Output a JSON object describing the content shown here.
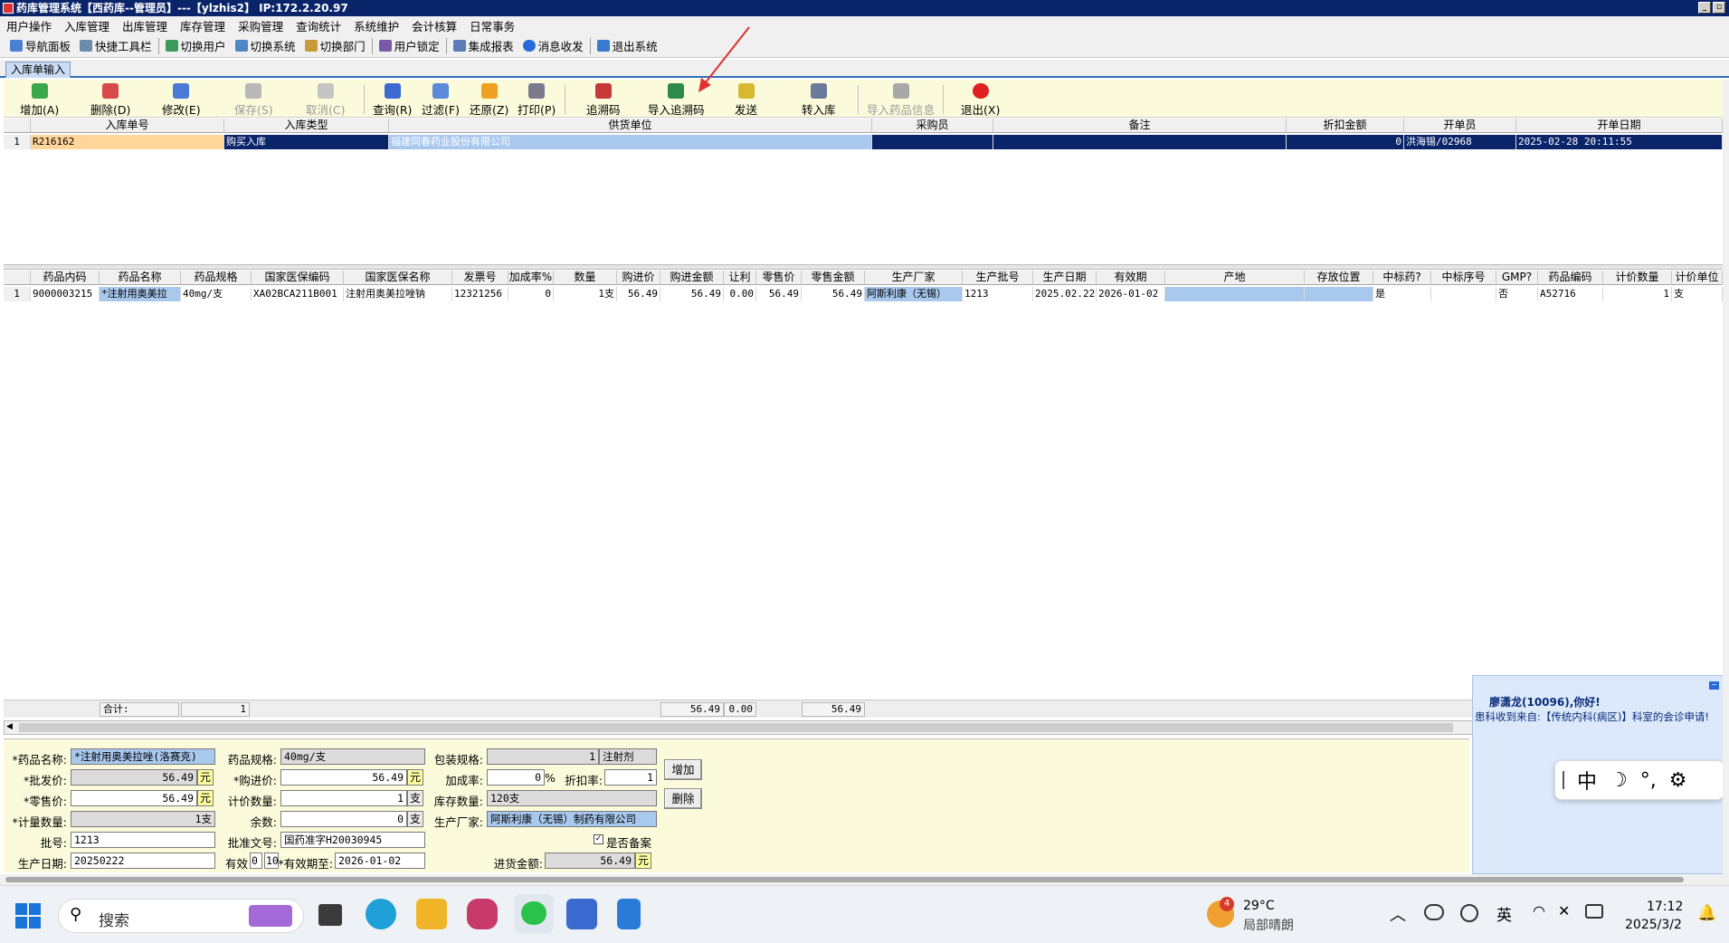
{
  "window": {
    "title": "药库管理系统【西药库--管理员】---【ylzhis2】 IP:172.2.20.97"
  },
  "menu": [
    "用户操作",
    "入库管理",
    "出库管理",
    "库存管理",
    "采购管理",
    "查询统计",
    "系统维护",
    "会计核算",
    "日常事务"
  ],
  "toolbar1": [
    "导航面板",
    "快捷工具栏",
    "切换用户",
    "切换系统",
    "切换部门",
    "用户锁定",
    "集成报表",
    "消息收发",
    "退出系统"
  ],
  "tab": {
    "active": "入库单输入"
  },
  "toolbar2": [
    {
      "label": "增加(A)",
      "enabled": true
    },
    {
      "label": "删除(D)",
      "enabled": true
    },
    {
      "label": "修改(E)",
      "enabled": true
    },
    {
      "label": "保存(S)",
      "enabled": false
    },
    {
      "label": "取消(C)",
      "enabled": false
    },
    {
      "label": "查询(R)",
      "enabled": true
    },
    {
      "label": "过滤(F)",
      "enabled": true
    },
    {
      "label": "还原(Z)",
      "enabled": true
    },
    {
      "label": "打印(P)",
      "enabled": true
    },
    {
      "label": "追溯码",
      "enabled": true
    },
    {
      "label": "导入追溯码",
      "enabled": true
    },
    {
      "label": "发送",
      "enabled": true
    },
    {
      "label": "转入库",
      "enabled": true
    },
    {
      "label": "导入药品信息",
      "enabled": false
    },
    {
      "label": "退出(X)",
      "enabled": true
    }
  ],
  "top_grid": {
    "headers": [
      "入库单号",
      "入库类型",
      "供货单位",
      "采购员",
      "备注",
      "折扣金额",
      "开单员",
      "开单日期"
    ],
    "rows": [
      {
        "no": "1",
        "cells": [
          "R216162",
          "购买入库",
          "福建同春药业股份有限公司",
          "",
          "",
          "0",
          "洪海锡/02968",
          "2025-02-28 20:11:55"
        ]
      }
    ]
  },
  "detail_grid": {
    "headers": [
      "药品内码",
      "药品名称",
      "药品规格",
      "国家医保编码",
      "国家医保名称",
      "发票号",
      "加成率%",
      "数量",
      "购进价",
      "购进金额",
      "让利",
      "零售价",
      "零售金额",
      "生产厂家",
      "生产批号",
      "生产日期",
      "有效期",
      "产地",
      "存放位置",
      "中标药?",
      "中标序号",
      "GMP?",
      "药品编码",
      "计价数量",
      "计价单位"
    ],
    "rows": [
      {
        "no": "1",
        "cells": [
          "9000003215",
          "*注射用奥美拉",
          "40mg/支",
          "XA02BCA211B001",
          "注射用奥美拉唑钠",
          "12321256",
          "0",
          "1支",
          "56.49",
          "56.49",
          "0.00",
          "56.49",
          "56.49",
          "阿斯利康（无锡）",
          "1213",
          "2025.02.22",
          "2026-01-02",
          "",
          "",
          "是",
          "",
          "否",
          "A52716",
          "1",
          "支"
        ]
      }
    ]
  },
  "summary": {
    "label": "合计:",
    "qty": "1",
    "purchase_amount": "56.49",
    "discount": "0.00",
    "retail_amount": "56.49"
  },
  "form": {
    "drug_name_label": "*药品名称:",
    "drug_name": "*注射用奥美拉唑(洛赛克)",
    "wholesale_label": "*批发价:",
    "wholesale": "56.49",
    "retail_label": "*零售价:",
    "retail": "56.49",
    "measure_qty_label": "*计量数量:",
    "measure_qty": "1支",
    "batch_label": "批号:",
    "batch": "1213",
    "prod_date_label": "生产日期:",
    "prod_date": "20250222",
    "spec_label": "药品规格:",
    "spec": "40mg/支",
    "purchase_price_label": "*购进价:",
    "purchase_price": "56.49",
    "price_qty_label": "计价数量:",
    "price_qty": "1",
    "remainder_label": "余数:",
    "remainder": "0",
    "approval_label": "批准文号:",
    "approval": "国药准字H20030945",
    "valid_label": "有效",
    "valid_a": "0",
    "valid_b": "10",
    "expiry_label": "*有效期至:",
    "expiry": "2026-01-02",
    "pack_spec_label": "包装规格:",
    "pack_spec": "1",
    "pack_form": "注射剂",
    "markup_label": "加成率:",
    "markup": "0",
    "pct": "%",
    "discount_rate_label": "折扣率:",
    "discount_rate": "1",
    "stock_label": "库存数量:",
    "stock": "120支",
    "maker_label": "生产厂家:",
    "maker": "阿斯利康（无锡）制药有限公司",
    "filed_label": "是否备案",
    "amount_label": "进货金额:",
    "amount": "56.49",
    "unit_yuan": "元",
    "unit_zhi": "支",
    "add_btn": "增加",
    "delete_btn": "删除"
  },
  "notify": {
    "greeting": "廖潇龙(10096),你好!",
    "message": "患科收到来自:【传统内科(病区)】科室的会诊申请!"
  },
  "ime": [
    "中",
    "☽",
    "°,",
    "⚙"
  ],
  "taskbar": {
    "search": "搜索",
    "weather_temp": "29°C",
    "weather_desc": "局部晴朗",
    "weather_badge": "4",
    "lang": "英",
    "time": "17:12",
    "date": "2025/3/2"
  }
}
